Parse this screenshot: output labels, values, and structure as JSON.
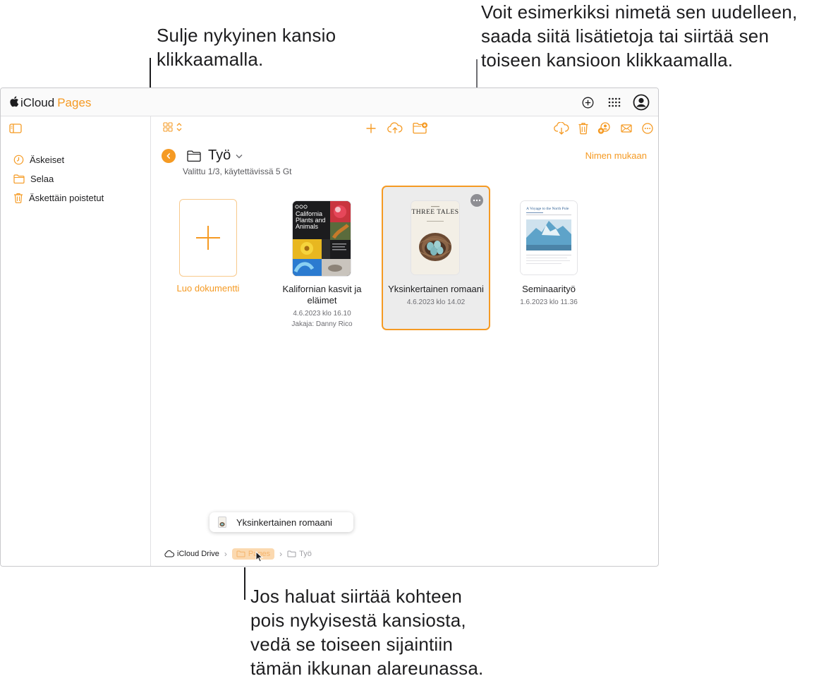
{
  "callouts": {
    "top_left": [
      "Sulje nykyinen kansio",
      "klikkaamalla."
    ],
    "top_right": [
      "Voit esimerkiksi nimetä sen uudelleen,",
      "saada siitä lisätietoja tai siirtää sen",
      "toiseen kansioon klikkaamalla."
    ],
    "bottom": [
      "Jos haluat siirtää kohteen",
      "pois nykyisestä kansiosta,",
      "vedä se toiseen sijaintiin",
      "tämän ikkunan alareunassa."
    ]
  },
  "app": {
    "brand_icloud": "iCloud",
    "brand_pages": "Pages",
    "accent": "#f59a23",
    "topbar_icons": [
      "add-circle-icon",
      "app-grid-icon",
      "account-icon"
    ]
  },
  "sidebar": {
    "items": [
      {
        "label": "Äskeiset",
        "icon": "clock-icon"
      },
      {
        "label": "Selaa",
        "icon": "folder-icon"
      },
      {
        "label": "Äskettäin poistetut",
        "icon": "trash-icon"
      }
    ]
  },
  "folder": {
    "title": "Työ",
    "subline": "Valittu 1/3, käytettävissä 5 Gt",
    "sort": "Nimen mukaan"
  },
  "documents": {
    "new_label": "Luo dokumentti",
    "items": [
      {
        "name": "Kalifornian kasvit ja eläimet",
        "name_lines": [
          "Kalifornian kasvit ja",
          "eläimet"
        ],
        "date": "4.6.2023 klo 16.10",
        "shared": "Jakaja: Danny Rico",
        "thumb_text": [
          "California",
          "Plants and",
          "Animals"
        ]
      },
      {
        "name": "Yksinkertainen romaani",
        "date": "4.6.2023 klo 14.02",
        "thumb_text": "THREE TALES",
        "selected": true
      },
      {
        "name": "Seminaarityö",
        "date": "1.6.2023 klo 11.36",
        "thumb_text": "A Voyage to the North Pole"
      }
    ]
  },
  "drag_chip": {
    "label": "Yksinkertainen romaani"
  },
  "breadcrumb": {
    "items": [
      "iCloud Drive",
      "Pages",
      "Työ"
    ]
  }
}
